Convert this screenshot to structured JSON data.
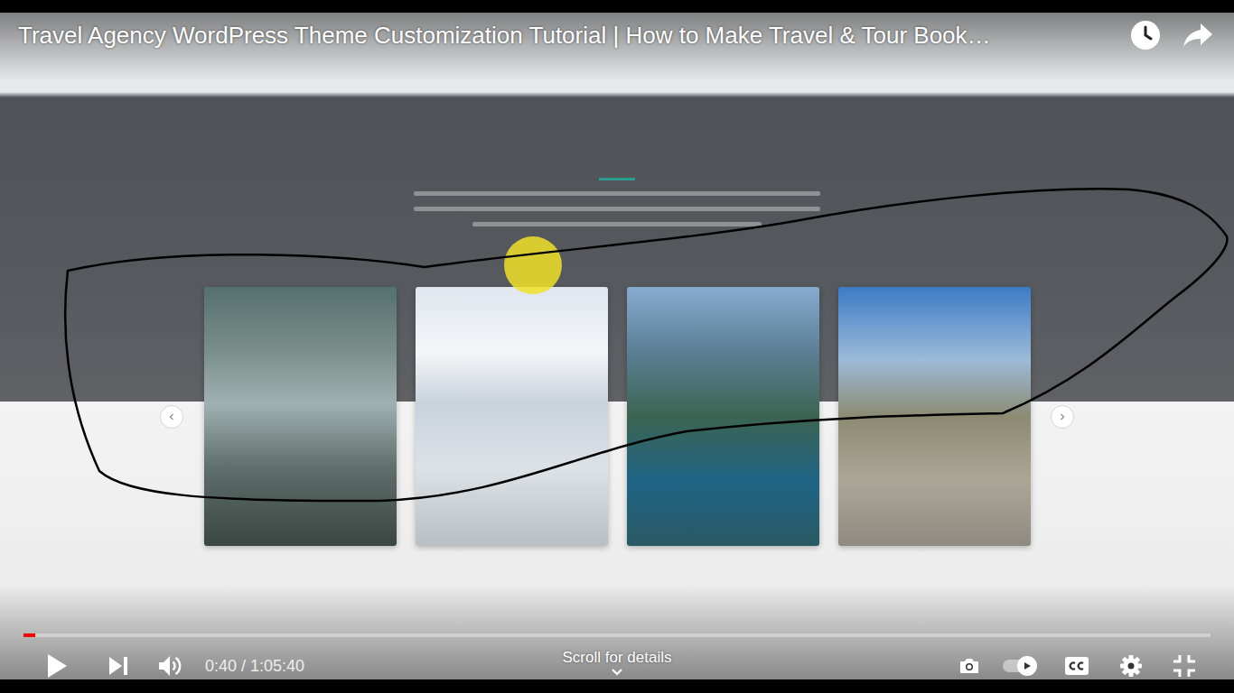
{
  "player": {
    "title": "Travel Agency WordPress Theme Customization Tutorial | How to Make Travel & Tour Book…",
    "time": "0:40 / 1:05:40",
    "progress": {
      "level": 0.01
    },
    "volume": {
      "muted": false
    },
    "autoplay": {
      "on": true
    },
    "scroll_hint": "Scroll for details"
  }
}
